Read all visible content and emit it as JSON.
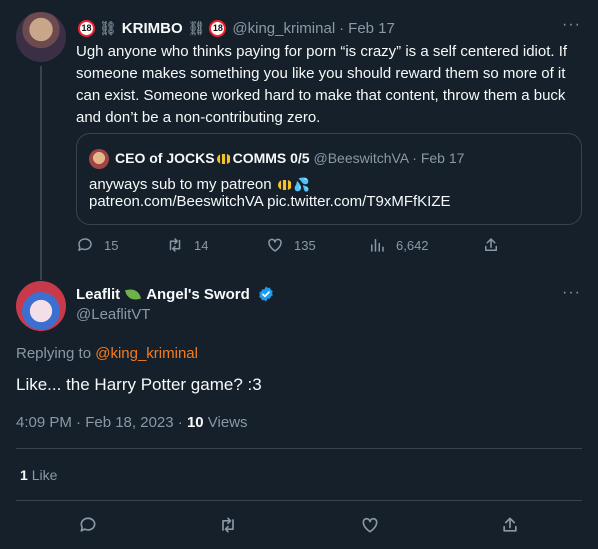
{
  "tweet1": {
    "badge": "18",
    "display_name": "KRIMBO",
    "handle": "@king_kriminal",
    "date": "Feb 17",
    "body": "Ugh anyone who thinks paying for porn “is crazy” is a self centered idiot. If someone makes something you like you should reward them so more of it can exist. Someone worked hard to make that content, throw them a buck and don’t be a non-contributing zero.",
    "quote": {
      "name_part1": "CEO of JOCKS",
      "name_part2": "COMMS 0/5",
      "handle": "@BeeswitchVA",
      "date": "Feb 17",
      "line1": "anyways sub to my patreon",
      "line2": "patreon.com/BeeswitchVA pic.twitter.com/T9xMFfKIZE"
    },
    "stats": {
      "replies": "15",
      "retweets": "14",
      "likes": "135",
      "views": "6,642"
    }
  },
  "tweet2": {
    "display_name_1": "Leaflit",
    "display_name_2": "Angel's Sword",
    "handle": "@LeaflitVT",
    "replying_label": "Replying to",
    "replying_to": "@king_kriminal",
    "text": "Like... the Harry Potter game?  :3",
    "time": "4:09 PM · Feb 18, 2023 ·",
    "views_count": "10",
    "views_label": "Views",
    "likes_count": "1",
    "likes_label": "Like"
  },
  "ui": {
    "more": "···",
    "sep": "·"
  },
  "colors": {
    "background": "#15202b",
    "muted": "#8b98a5",
    "accent_orange": "#f47c20",
    "verified": "#1d9bf0"
  },
  "icons": [
    "reply-icon",
    "retweet-icon",
    "like-icon",
    "views-icon",
    "share-icon",
    "verified-icon",
    "more-icon"
  ]
}
